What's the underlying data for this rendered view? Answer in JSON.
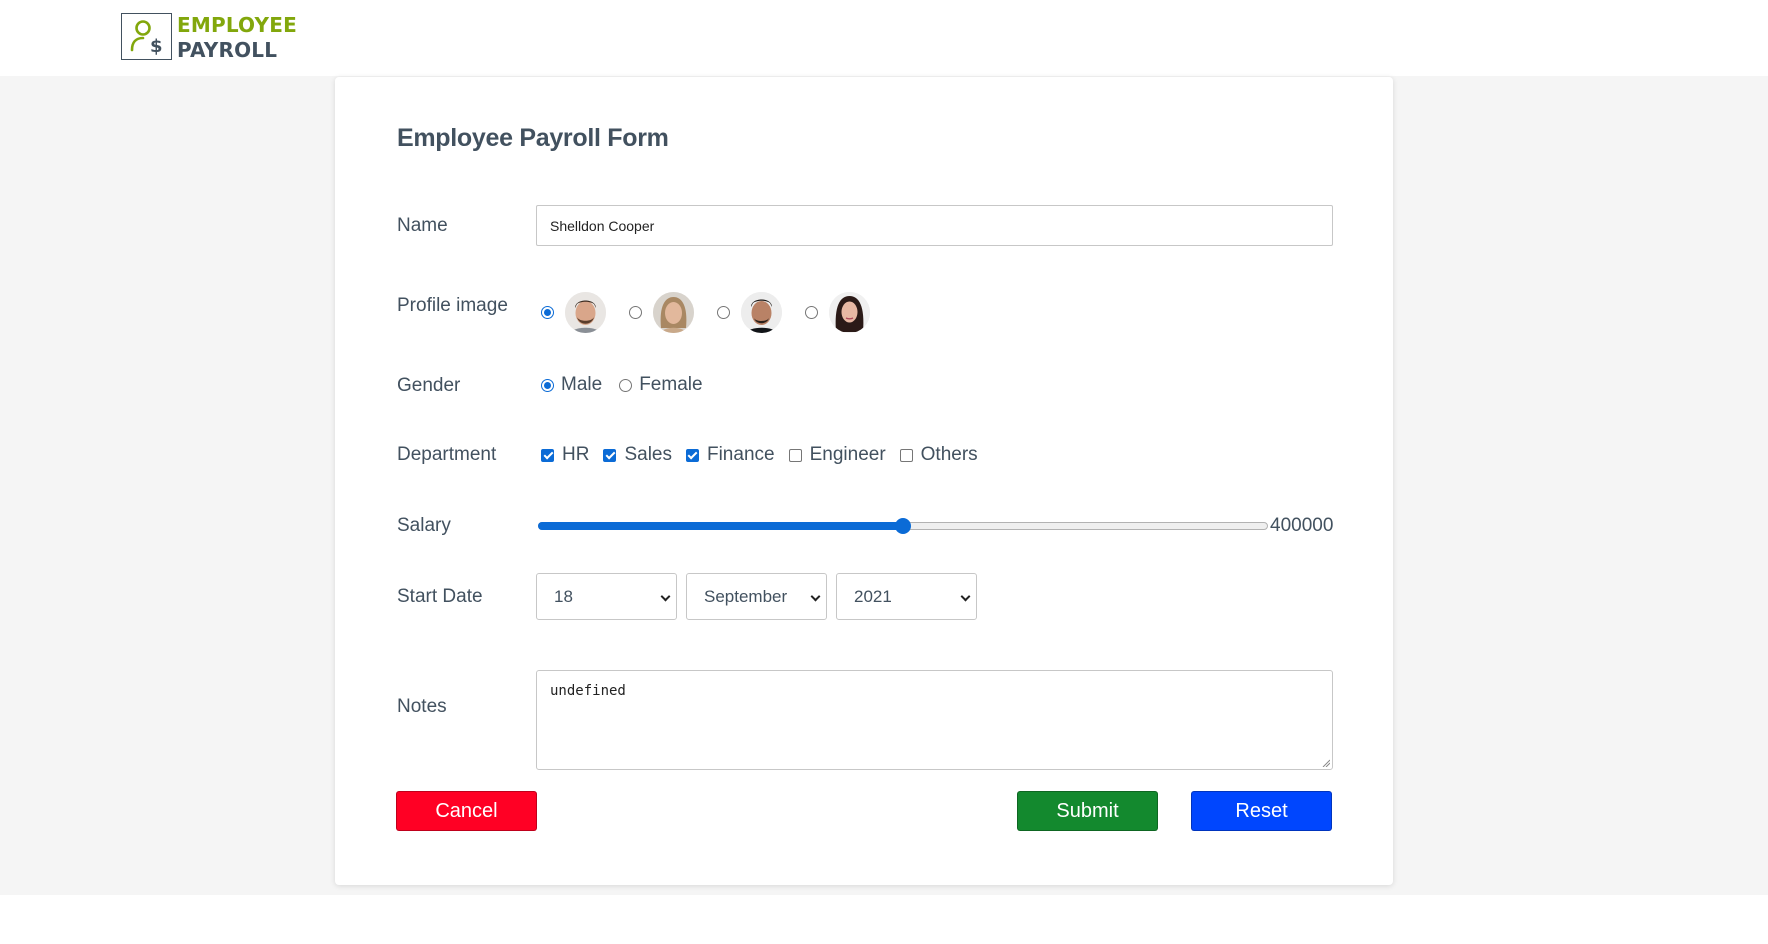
{
  "header": {
    "logo_line1": "EMPLOYEE",
    "logo_line2": "PAYROLL",
    "logo_icon": "user-dollar-icon"
  },
  "form": {
    "title": "Employee Payroll Form",
    "name": {
      "label": "Name",
      "value": "Shelldon Cooper"
    },
    "profile": {
      "label": "Profile image",
      "options": [
        {
          "avatar": "male-avatar-1",
          "selected": true
        },
        {
          "avatar": "female-avatar-1",
          "selected": false
        },
        {
          "avatar": "male-avatar-2",
          "selected": false
        },
        {
          "avatar": "female-avatar-2",
          "selected": false
        }
      ]
    },
    "gender": {
      "label": "Gender",
      "options": [
        {
          "label": "Male",
          "selected": true
        },
        {
          "label": "Female",
          "selected": false
        }
      ]
    },
    "department": {
      "label": "Department",
      "options": [
        {
          "label": "HR",
          "checked": true
        },
        {
          "label": "Sales",
          "checked": true
        },
        {
          "label": "Finance",
          "checked": true
        },
        {
          "label": "Engineer",
          "checked": false
        },
        {
          "label": "Others",
          "checked": false
        }
      ]
    },
    "salary": {
      "label": "Salary",
      "value": "400000",
      "fraction": 0.5
    },
    "start_date": {
      "label": "Start Date",
      "day": "18",
      "month": "September",
      "year": "2021"
    },
    "notes": {
      "label": "Notes",
      "value": "undefined"
    },
    "buttons": {
      "cancel": "Cancel",
      "submit": "Submit",
      "reset": "Reset"
    }
  },
  "colors": {
    "accent": "#0b6bd6",
    "cancel": "#ff0024",
    "submit": "#13892e",
    "reset": "#0046fe",
    "logo_green": "#82a70c",
    "text": "#42515f"
  }
}
